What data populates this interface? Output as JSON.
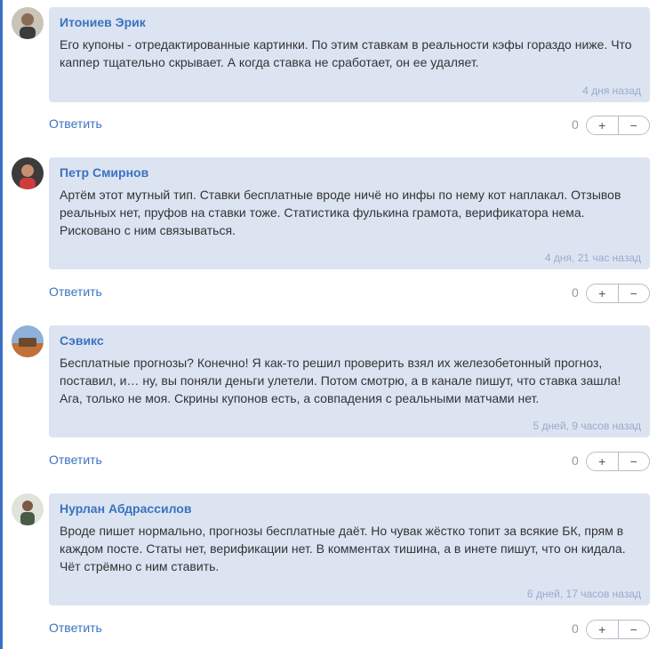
{
  "comments": [
    {
      "author": "Итониев Эрик",
      "text": "Его купоны - отредактированные картинки. По этим ставкам в реальности кэфы гораздо ниже. Что каппер тщательно скрывает. А когда ставка не сработает, он ее удаляет.",
      "time": "4 дня назад",
      "reply": "Ответить",
      "score": "0",
      "plus": "+",
      "minus": "−"
    },
    {
      "author": "Петр Смирнов",
      "text": "Артём этот мутный тип. Ставки бесплатные вроде ничё но инфы по нему кот наплакал. Отзывов реальных нет, пруфов на ставки тоже. Статистика фулькина грамота, верификатора нема. Рисковано с ним связываться.",
      "time": "4 дня, 21 час назад",
      "reply": "Ответить",
      "score": "0",
      "plus": "+",
      "minus": "−"
    },
    {
      "author": "Сэвикс",
      "text": "Бесплатные прогнозы? Конечно! Я как-то решил проверить взял их железобетонный прогноз, поставил, и… ну, вы поняли деньги улетели. Потом смотрю, а в канале пишут, что ставка зашла! Ага, только не моя. Скрины купонов есть, а совпадения с реальными матчами нет.",
      "time": "5 дней, 9 часов назад",
      "reply": "Ответить",
      "score": "0",
      "plus": "+",
      "minus": "−"
    },
    {
      "author": "Нурлан Абдрассилов",
      "text": "Вроде пишет нормально, прогнозы бесплатные даёт. Но чувак жёстко топит за всякие БК, прям в каждом посте. Статы нет, верификации нет. В комментах тишина, а в инете пишут, что он кидала. Чёт стрёмно с ним ставить.",
      "time": "6 дней, 17 часов назад",
      "reply": "Ответить",
      "score": "0",
      "plus": "+",
      "minus": "−"
    }
  ]
}
